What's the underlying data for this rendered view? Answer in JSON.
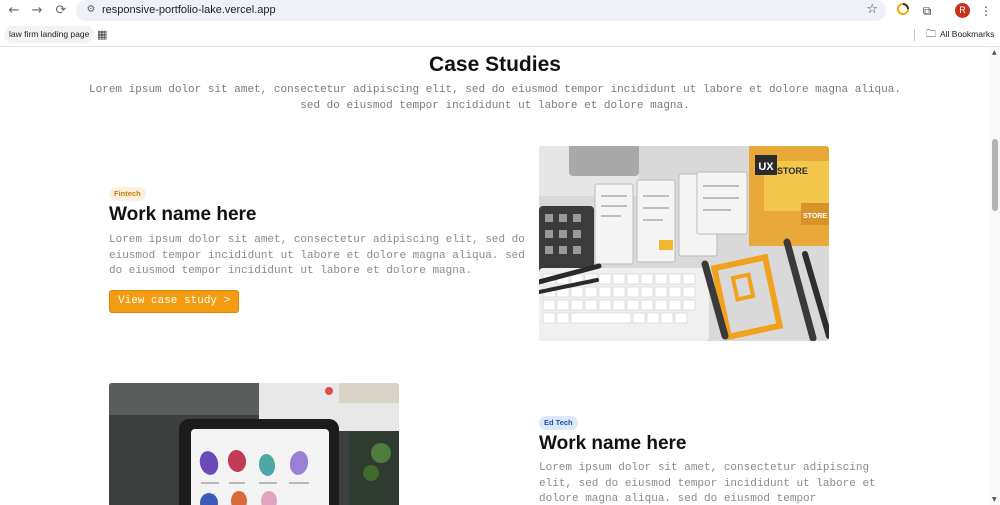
{
  "browser": {
    "url": "responsive-portfolio-lake.vercel.app",
    "profile_initial": "R",
    "bookmark": "law firm landing page",
    "all_bookmarks": "All Bookmarks"
  },
  "icons": {
    "back": "←",
    "forward": "→",
    "reload": "⟳",
    "site_info": "⚙",
    "star": "☆",
    "puzzle": "⧉",
    "menu": "⋮",
    "apps": "▦",
    "folder": "🗀"
  },
  "section": {
    "title": "Case Studies",
    "subtitle": "Lorem ipsum dolor sit amet, consectetur adipiscing elit, sed do eiusmod tempor incididunt ut labore et dolore magna aliqua. sed do eiusmod tempor incididunt ut labore et dolore magna."
  },
  "projects": [
    {
      "tag": "Fintech",
      "title": "Work name here",
      "description": "Lorem ipsum dolor sit amet, consectetur adipiscing elit, sed do eiusmod tempor incididunt ut labore et dolore magna aliqua. sed do eiusmod tempor incididunt ut labore et dolore magna.",
      "cta": "View case study >"
    },
    {
      "tag": "Ed Tech",
      "title": "Work name here",
      "description": "Lorem ipsum dolor sit amet, consectetur adipiscing elit, sed do eiusmod tempor incididunt ut labore et dolore magna aliqua. sed do eiusmod tempor incididunt"
    }
  ],
  "image_text": {
    "ux_badge": "UX",
    "store": "STORE"
  },
  "colors": {
    "accent": "#f39c11",
    "fintech_tag_bg": "#fdf0dd",
    "edtech_tag_bg": "#dde9fb"
  }
}
